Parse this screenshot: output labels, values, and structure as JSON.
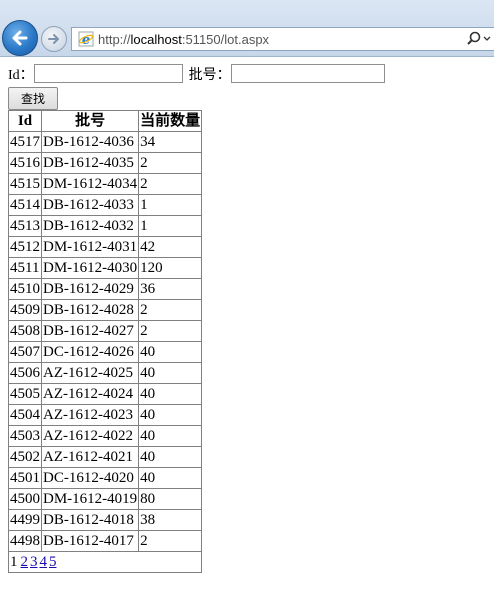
{
  "browser": {
    "url_prefix": "http://",
    "url_host": "localhost",
    "url_rest": ":51150/lot.aspx"
  },
  "search": {
    "id_label": "Id：",
    "id_value": "",
    "batch_label": "批号：",
    "batch_value": "",
    "find_button": "查找"
  },
  "table": {
    "headers": [
      "Id",
      "批号",
      "当前数量"
    ],
    "rows": [
      [
        "4517",
        "DB-1612-4036",
        "34"
      ],
      [
        "4516",
        "DB-1612-4035",
        "2"
      ],
      [
        "4515",
        "DM-1612-4034",
        "2"
      ],
      [
        "4514",
        "DB-1612-4033",
        "1"
      ],
      [
        "4513",
        "DB-1612-4032",
        "1"
      ],
      [
        "4512",
        "DM-1612-4031",
        "42"
      ],
      [
        "4511",
        "DM-1612-4030",
        "120"
      ],
      [
        "4510",
        "DB-1612-4029",
        "36"
      ],
      [
        "4509",
        "DB-1612-4028",
        "2"
      ],
      [
        "4508",
        "DB-1612-4027",
        "2"
      ],
      [
        "4507",
        "DC-1612-4026",
        "40"
      ],
      [
        "4506",
        "AZ-1612-4025",
        "40"
      ],
      [
        "4505",
        "AZ-1612-4024",
        "40"
      ],
      [
        "4504",
        "AZ-1612-4023",
        "40"
      ],
      [
        "4503",
        "AZ-1612-4022",
        "40"
      ],
      [
        "4502",
        "AZ-1612-4021",
        "40"
      ],
      [
        "4501",
        "DC-1612-4020",
        "40"
      ],
      [
        "4500",
        "DM-1612-4019",
        "80"
      ],
      [
        "4499",
        "DB-1612-4018",
        "38"
      ],
      [
        "4498",
        "DB-1612-4017",
        "2"
      ]
    ]
  },
  "pager": {
    "current": "1",
    "pages": [
      "2",
      "3",
      "4",
      "5"
    ]
  }
}
